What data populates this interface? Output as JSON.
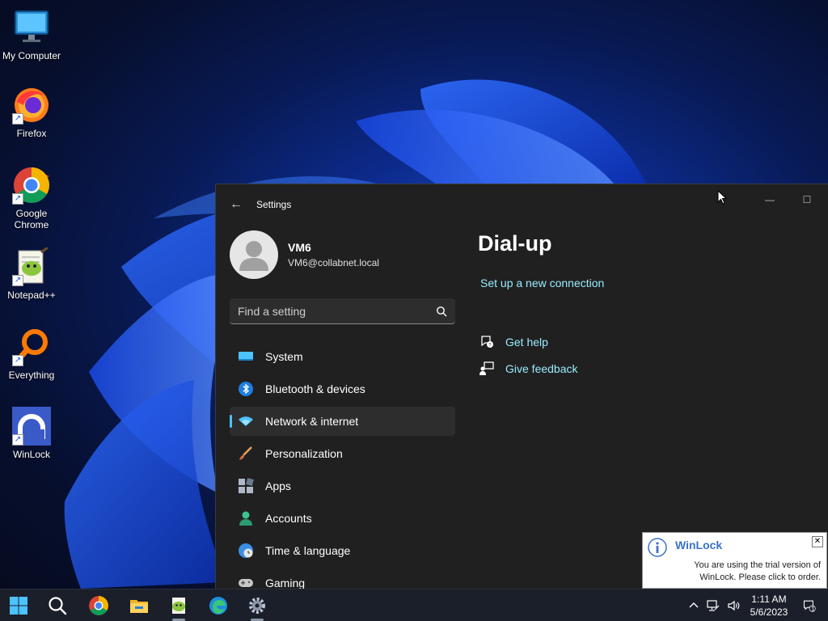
{
  "desktop": {
    "icons": [
      {
        "label": "My Computer"
      },
      {
        "label": "Firefox"
      },
      {
        "label": "Google Chrome"
      },
      {
        "label": "Notepad++"
      },
      {
        "label": "Everything"
      },
      {
        "label": "WinLock"
      }
    ],
    "shortcut_glyph": "↗"
  },
  "settings": {
    "title": "Settings",
    "back_glyph": "←",
    "minimize_glyph": "—",
    "maximize_glyph": "☐",
    "profile": {
      "name": "VM6",
      "email": "VM6@collabnet.local"
    },
    "search": {
      "placeholder": "Find a setting",
      "value": ""
    },
    "nav": [
      {
        "label": "System",
        "icon": "monitor-icon"
      },
      {
        "label": "Bluetooth & devices",
        "icon": "bluetooth-icon"
      },
      {
        "label": "Network & internet",
        "icon": "wifi-icon",
        "active": true
      },
      {
        "label": "Personalization",
        "icon": "brush-icon"
      },
      {
        "label": "Apps",
        "icon": "apps-icon"
      },
      {
        "label": "Accounts",
        "icon": "person-icon"
      },
      {
        "label": "Time & language",
        "icon": "globe-clock-icon"
      },
      {
        "label": "Gaming",
        "icon": "gamepad-icon"
      }
    ],
    "page": {
      "title": "Dial-up",
      "setup_link": "Set up a new connection",
      "get_help": "Get help",
      "give_feedback": "Give feedback"
    },
    "accent": "#4cc2ff",
    "link_color": "#99ebff"
  },
  "notification": {
    "title": "WinLock",
    "body": "You are using the trial version of WinLock. Please click to order.",
    "close_glyph": "✕"
  },
  "taskbar": {
    "clock_time": "1:11 AM",
    "clock_date": "5/6/2023",
    "tray_chevron": "^",
    "notification_count": "1"
  }
}
